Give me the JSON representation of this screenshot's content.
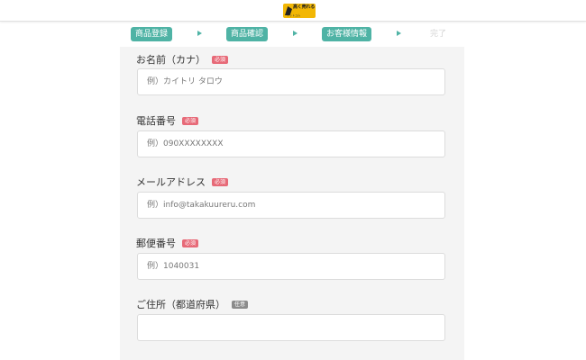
{
  "header": {
    "logo_text": "高く売れる",
    "logo_sub": "ドットコム"
  },
  "steps": [
    {
      "label": "商品登録",
      "state": "complete"
    },
    {
      "label": "商品確認",
      "state": "complete"
    },
    {
      "label": "お客様情報",
      "state": "current"
    },
    {
      "label": "完了",
      "state": "pending"
    }
  ],
  "form": {
    "name": {
      "label": "お名前（カナ）",
      "badge": "必須",
      "placeholder": "例）カイトリ タロウ",
      "value": ""
    },
    "phone": {
      "label": "電話番号",
      "badge": "必須",
      "placeholder": "例）090XXXXXXXX",
      "value": ""
    },
    "email": {
      "label": "メールアドレス",
      "badge": "必須",
      "placeholder": "例）info@takakuureru.com",
      "value": ""
    },
    "postal": {
      "label": "郵便番号",
      "badge": "必須",
      "placeholder": "例）1040031",
      "value": ""
    },
    "address": {
      "label": "ご住所（都道府県）",
      "badge": "任意",
      "placeholder": "",
      "value": ""
    }
  },
  "colors": {
    "accent": "#4fb3a5",
    "required_badge": "#e76a78",
    "optional_badge": "#8b8b8b",
    "logo": "#f2b705",
    "panel": "#f4f4f4"
  }
}
